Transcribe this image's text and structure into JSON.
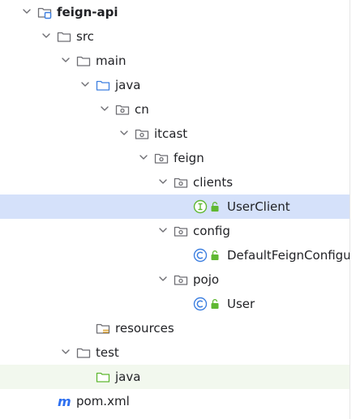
{
  "colors": {
    "selection": "#d5e1fa",
    "test_highlight": "#f2f8ee",
    "folder_stroke": "#6e6e73",
    "source_folder": "#3d7fe0",
    "test_folder": "#5fb832",
    "interface_icon": "#5fb832",
    "class_icon": "#3d7fe0",
    "maven": "#2d6ff0"
  },
  "tree": [
    {
      "label": "feign-api",
      "icon": "module-folder-icon",
      "chevron": "expanded",
      "bold": true
    },
    {
      "label": "src",
      "icon": "folder-icon",
      "chevron": "expanded"
    },
    {
      "label": "main",
      "icon": "folder-icon",
      "chevron": "expanded"
    },
    {
      "label": "java",
      "icon": "source-folder-icon",
      "chevron": "expanded"
    },
    {
      "label": "cn",
      "icon": "package-icon",
      "chevron": "expanded"
    },
    {
      "label": "itcast",
      "icon": "package-icon",
      "chevron": "expanded"
    },
    {
      "label": "feign",
      "icon": "package-icon",
      "chevron": "expanded"
    },
    {
      "label": "clients",
      "icon": "package-icon",
      "chevron": "expanded"
    },
    {
      "label": "UserClient",
      "icon": "interface-icon",
      "lock": true,
      "selected": true
    },
    {
      "label": "config",
      "icon": "package-icon",
      "chevron": "expanded"
    },
    {
      "label": "DefaultFeignConfigu",
      "icon": "class-icon",
      "lock": true
    },
    {
      "label": "pojo",
      "icon": "package-icon",
      "chevron": "expanded"
    },
    {
      "label": "User",
      "icon": "class-icon",
      "lock": true
    },
    {
      "label": "resources",
      "icon": "resources-folder-icon"
    },
    {
      "label": "test",
      "icon": "folder-icon",
      "chevron": "expanded"
    },
    {
      "label": "java",
      "icon": "test-folder-icon",
      "highlight": true
    },
    {
      "label": "pom.xml",
      "icon": "maven-icon"
    }
  ]
}
